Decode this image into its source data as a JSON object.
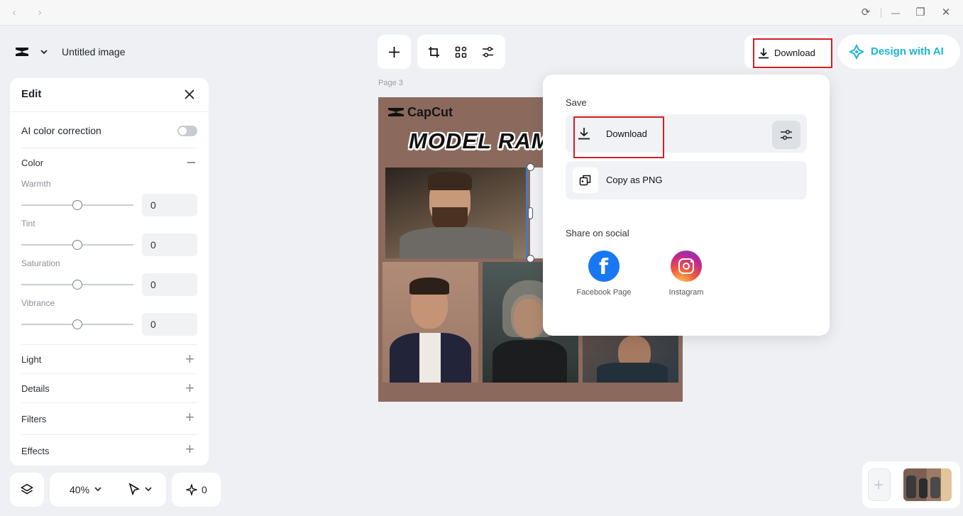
{
  "window": {
    "back": "‹",
    "forward": "›",
    "reload": "⟳",
    "minimize": "—",
    "restore": "❐",
    "close": "✕"
  },
  "header": {
    "project_title": "Untitled image",
    "download_label": "Download",
    "design_ai_label": "Design with AI"
  },
  "edit_panel": {
    "title": "Edit",
    "ai_color_correction": "AI color correction",
    "color_section": "Color",
    "sliders": [
      {
        "label": "Warmth",
        "value": "0",
        "level": 0.5
      },
      {
        "label": "Tint",
        "value": "0",
        "level": 0.5
      },
      {
        "label": "Saturation",
        "value": "0",
        "level": 0.5
      },
      {
        "label": "Vibrance",
        "value": "0",
        "level": 0.5
      }
    ],
    "sections": [
      "Light",
      "Details",
      "Filters",
      "Effects"
    ]
  },
  "canvas": {
    "page_label": "Page 3",
    "brand": "CapCut",
    "headline": "MODEL RAMBU"
  },
  "download_menu": {
    "save_heading": "Save",
    "download_label": "Download",
    "copy_label": "Copy as PNG",
    "share_heading": "Share on social",
    "facebook_label": "Facebook Page",
    "instagram_label": "Instagram"
  },
  "bottom": {
    "zoom": "40%",
    "magic_count": "0"
  },
  "colors": {
    "accent": "#1bb6d6",
    "highlight": "#d21e25",
    "canvas_bg": "#8b6a5d",
    "facebook": "#1877f2"
  }
}
